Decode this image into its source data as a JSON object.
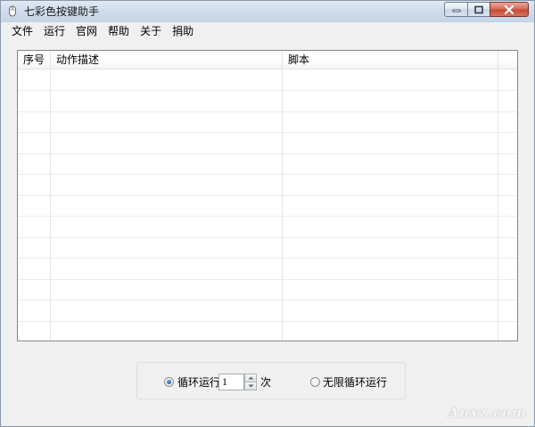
{
  "window": {
    "title": "七彩色按键助手",
    "icon": "mouse-icon"
  },
  "caption_buttons": {
    "minimize_icon": "minimize-icon",
    "maximize_icon": "maximize-icon",
    "close_icon": "close-icon"
  },
  "menu": {
    "items": [
      {
        "label": "文件"
      },
      {
        "label": "运行"
      },
      {
        "label": "官网"
      },
      {
        "label": "帮助"
      },
      {
        "label": "关于"
      },
      {
        "label": "捐助"
      }
    ]
  },
  "list": {
    "columns": [
      {
        "label": "序号"
      },
      {
        "label": "动作描述"
      },
      {
        "label": "脚本"
      },
      {
        "label": ""
      }
    ],
    "rows": []
  },
  "loop": {
    "loop_label": "循环运行",
    "loop_checked": true,
    "count_value": "1",
    "count_unit": "次",
    "infinite_label": "无限循环运行",
    "infinite_checked": false
  },
  "watermark": {
    "text": "Anxz.com"
  },
  "colors": {
    "accent": "#1a5fb4",
    "close_button": "#c74a34",
    "window_bg": "#f0f0f0",
    "grid_line": "#ececec"
  }
}
